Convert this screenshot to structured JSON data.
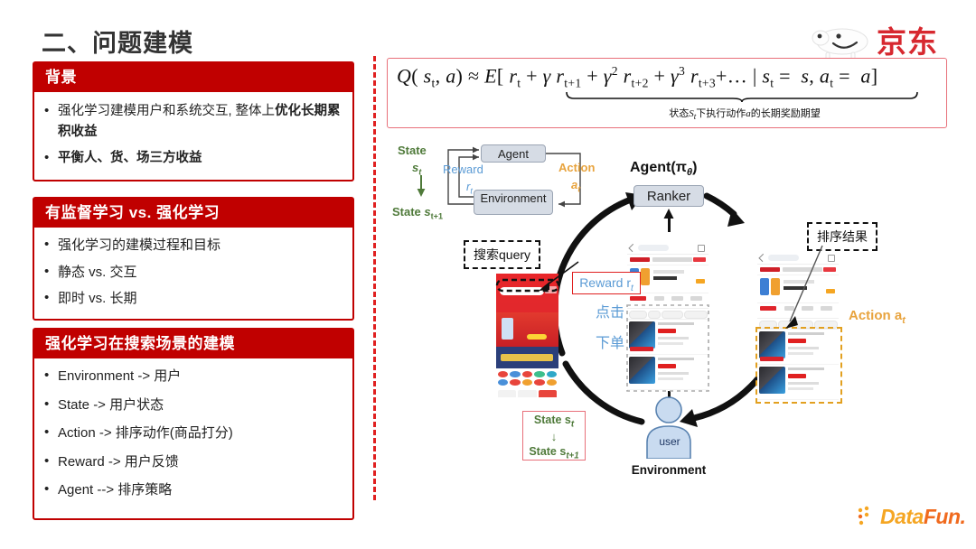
{
  "page": {
    "title": "二、问题建模"
  },
  "cards": [
    {
      "id": "background",
      "heading": "背景",
      "items": [
        {
          "plain": "强化学习建模用户和系统交互, 整体上",
          "bold": "优化长期累积收益"
        },
        {
          "plain": "",
          "bold": "平衡人、货、场三方收益"
        }
      ]
    },
    {
      "id": "compare",
      "heading": "有监督学习 vs. 强化学习",
      "items": [
        {
          "plain": "强化学习的建模过程和目标",
          "bold": ""
        },
        {
          "plain": "静态 vs. 交互",
          "bold": ""
        },
        {
          "plain": "即时 vs. 长期",
          "bold": ""
        }
      ]
    },
    {
      "id": "modeling",
      "heading": "强化学习在搜索场景的建模",
      "items": [
        {
          "plain": "Environment  -> 用户",
          "bold": ""
        },
        {
          "plain": "State  ->   用户状态",
          "bold": ""
        },
        {
          "plain": "Action  -> 排序动作(商品打分)",
          "bold": ""
        },
        {
          "plain": "Reward -> 用户反馈",
          "bold": ""
        },
        {
          "plain": "Agent  --> 排序策略",
          "bold": ""
        }
      ]
    }
  ],
  "formula": {
    "caption": "状态S_t下执行动作a的长期奖励期望",
    "caption_plain": "状态S下执行动作a的长期奖励期望"
  },
  "mdp": {
    "agent": "Agent",
    "environment": "Environment",
    "state": "State",
    "state_sub": "s",
    "state_next": "State s",
    "reward": "Reward",
    "reward_sub": "r",
    "action": "Action",
    "action_sub": "a"
  },
  "cycle": {
    "agent_pi": "Agent(π",
    "agent_pi_sub": "θ",
    "ranker": "Ranker",
    "query_label": "搜索query",
    "rank_result_label": "排序结果",
    "reward_label": "Reward r",
    "click": "点击",
    "order": "下单",
    "action_label": "Action a",
    "state_now": "State s",
    "state_next": "State s",
    "state_arrow": "↓",
    "user": "user",
    "environment": "Environment"
  },
  "logos": {
    "jd": "京东",
    "datafun_data": "Data",
    "datafun_fun": "Fun."
  },
  "colors": {
    "brand_red": "#C00000",
    "divider_red": "#E02020",
    "green": "#4F7A3A",
    "blue": "#5B9BD5",
    "orange": "#E8A33D",
    "jd_red": "#D7282F",
    "datafun_yellow": "#F5A623",
    "datafun_orange": "#F06A1E",
    "box_gray": "#D6DCE5"
  }
}
